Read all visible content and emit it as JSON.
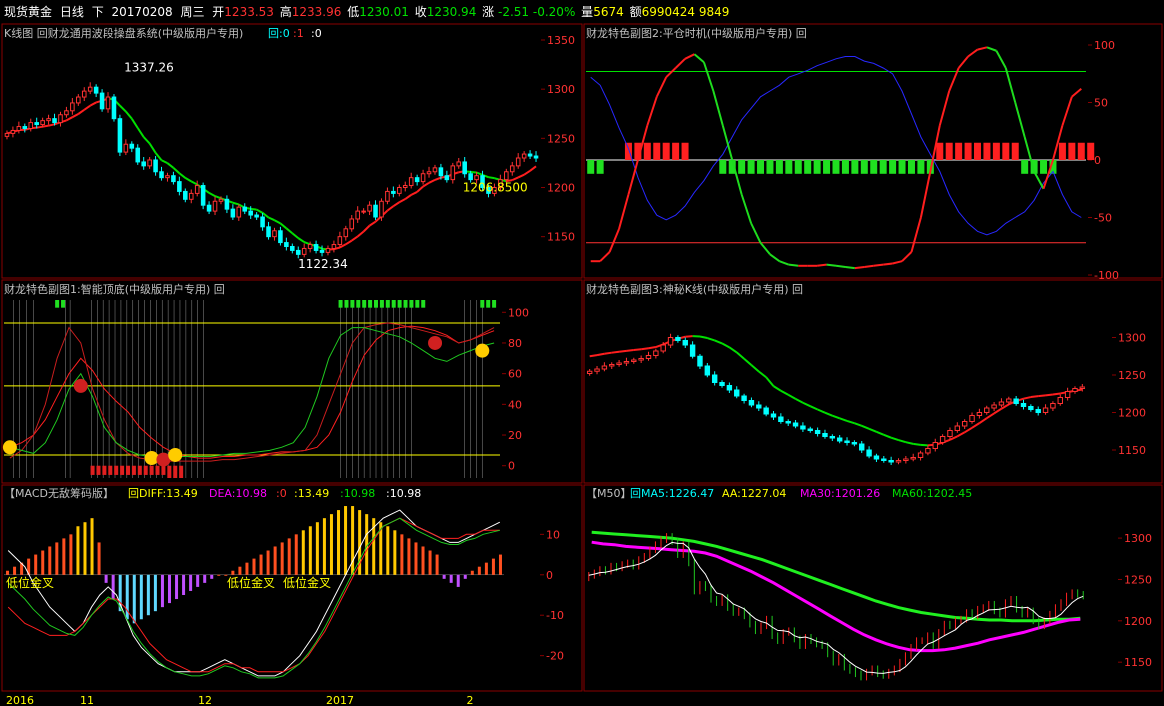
{
  "topbar": {
    "symbol": "现货黄金",
    "period": "日线",
    "direction": "下",
    "date": "20170208",
    "weekday": "周三",
    "open_label": "开",
    "open": "1233.53",
    "high_label": "高",
    "high": "1233.96",
    "low_label": "低",
    "low": "1230.01",
    "close_label": "收",
    "close": "1230.94",
    "change_label": "涨",
    "change": "-2.51",
    "change_pct": "-0.20%",
    "volume_label": "量",
    "volume": "5674",
    "amount_label": "额",
    "amount": "6990424",
    "extra": "9849"
  },
  "colors": {
    "up": "#ff3232",
    "down": "#00ffff",
    "frame": "#8a0000",
    "ma_green": "#00e000",
    "ma_red": "#ff1e1e",
    "yellow": "#ffff00",
    "magenta": "#ff00ff",
    "white": "#ffffff",
    "blue": "#2020ff"
  },
  "chart_data": [
    {
      "id": "kline",
      "type": "candlestick",
      "title": "K线图 回财龙通用波段操盘系统(中级版用户专用)",
      "legend": [
        {
          "text": "回:0",
          "color": "#00ffff"
        },
        {
          "text": ":1",
          "color": "#ff3232"
        },
        {
          "text": ":0",
          "color": "#ffffff"
        }
      ],
      "ylim": [
        1110,
        1350
      ],
      "yticks": [
        "1350",
        "1300",
        "1250",
        "1200",
        "1150"
      ],
      "annotations": [
        "1337.26",
        "1122.34",
        "1206.8500"
      ],
      "close": [
        1255,
        1258,
        1262,
        1260,
        1266,
        1264,
        1268,
        1270,
        1266,
        1274,
        1278,
        1286,
        1292,
        1298,
        1302,
        1296,
        1280,
        1292,
        1270,
        1236,
        1244,
        1240,
        1226,
        1222,
        1228,
        1216,
        1210,
        1212,
        1206,
        1196,
        1188,
        1194,
        1202,
        1182,
        1176,
        1186,
        1188,
        1178,
        1170,
        1180,
        1176,
        1172,
        1170,
        1160,
        1150,
        1156,
        1144,
        1140,
        1136,
        1132,
        1138,
        1142,
        1136,
        1134,
        1138,
        1142,
        1150,
        1158,
        1168,
        1176,
        1176,
        1182,
        1170,
        1186,
        1196,
        1194,
        1200,
        1202,
        1210,
        1206,
        1214,
        1216,
        1220,
        1212,
        1208,
        1222,
        1226,
        1214,
        1208,
        1212,
        1200,
        1194,
        1200,
        1208,
        1216,
        1222,
        1230,
        1234,
        1232,
        1230
      ]
    },
    {
      "id": "sub2",
      "type": "line",
      "title": "财龙特色副图2:平仓时机(中级版用户专用) 回",
      "ylim": [
        -100,
        100
      ],
      "yticks": [
        "100",
        "50",
        "0",
        "-50",
        "-100"
      ],
      "hlines": [
        77,
        -72,
        0
      ],
      "red": [
        -88,
        -88,
        -80,
        -60,
        -30,
        0,
        30,
        55,
        72,
        80,
        88,
        92,
        85,
        60,
        30,
        0,
        -30,
        -55,
        -72,
        -82,
        -88,
        -91,
        -92,
        -92,
        -92,
        -91,
        -92,
        -93,
        -94,
        -93,
        -92,
        -91,
        -90,
        -88,
        -80,
        -50,
        -10,
        30,
        60,
        80,
        90,
        96,
        98,
        95,
        80,
        50,
        20,
        -10,
        -25,
        0,
        30,
        55,
        62
      ],
      "blue": [
        72,
        65,
        48,
        28,
        10,
        -15,
        -35,
        -48,
        -52,
        -48,
        -40,
        -28,
        -18,
        -5,
        5,
        20,
        35,
        45,
        55,
        60,
        65,
        72,
        75,
        78,
        82,
        85,
        88,
        90,
        90,
        86,
        84,
        80,
        75,
        60,
        40,
        20,
        5,
        -10,
        -30,
        -45,
        -55,
        -62,
        -65,
        -62,
        -55,
        -50,
        -45,
        -35,
        -20,
        -10,
        -30,
        -45,
        -50
      ],
      "bars": [
        {
          "from": 0,
          "to": 1,
          "value": -12
        },
        {
          "from": 4,
          "to": 10,
          "value": 15
        },
        {
          "from": 14,
          "to": 36,
          "value": -12
        },
        {
          "from": 37,
          "to": 45,
          "value": 15
        },
        {
          "from": 46,
          "to": 49,
          "value": -12
        },
        {
          "from": 50,
          "to": 53,
          "value": 15
        }
      ]
    },
    {
      "id": "sub1",
      "type": "line",
      "title": "财龙特色副图1:智能顶底(中级版用户专用) 回",
      "ylim": [
        -8,
        108
      ],
      "yticks": [
        "100",
        "80",
        "60",
        "40",
        "20",
        "0"
      ],
      "hlines": [
        93,
        52,
        7
      ],
      "red_line": [
        12,
        15,
        20,
        30,
        45,
        60,
        70,
        62,
        50,
        42,
        35,
        25,
        18,
        12,
        8,
        6,
        5,
        5,
        6,
        6,
        7,
        7,
        8,
        9,
        9,
        10,
        12,
        20,
        35,
        55,
        72,
        82,
        88,
        90,
        91,
        90,
        88,
        85,
        80,
        82,
        85,
        88
      ],
      "red_line_b": [
        5,
        10,
        20,
        40,
        70,
        90,
        80,
        50,
        30,
        15,
        8,
        5,
        4,
        3,
        3,
        3,
        3,
        3,
        4,
        4,
        5,
        6,
        7,
        8,
        9,
        10,
        20,
        40,
        60,
        80,
        90,
        92,
        93,
        92,
        90,
        88,
        86,
        84,
        80,
        82,
        86,
        90
      ],
      "green_line": [
        12,
        10,
        8,
        15,
        30,
        50,
        60,
        45,
        25,
        15,
        10,
        7,
        6,
        6,
        6,
        6,
        6,
        6,
        7,
        8,
        8,
        9,
        10,
        12,
        15,
        25,
        45,
        70,
        85,
        90,
        90,
        88,
        86,
        84,
        80,
        75,
        70,
        68,
        72,
        75,
        78,
        80
      ],
      "dots": [
        {
          "x": 0,
          "y": 12,
          "kind": "smile"
        },
        {
          "x": 6,
          "y": 52,
          "kind": "red"
        },
        {
          "x": 12,
          "y": 5,
          "kind": "smile"
        },
        {
          "x": 13,
          "y": 4,
          "kind": "red"
        },
        {
          "x": 14,
          "y": 7,
          "kind": "smile"
        },
        {
          "x": 36,
          "y": 80,
          "kind": "red"
        },
        {
          "x": 40,
          "y": 75,
          "kind": "smile"
        }
      ],
      "bottom_bars": [
        {
          "from": 7,
          "to": 13,
          "value": -6
        },
        {
          "from": 13.5,
          "to": 14.5,
          "value": -8
        }
      ],
      "top_bars": [
        {
          "from": 4,
          "to": 4.5,
          "value": 103
        },
        {
          "from": 28,
          "to": 35,
          "value": 103
        },
        {
          "from": 40,
          "to": 41,
          "value": 103
        }
      ],
      "vlines": [
        0.3,
        0.8,
        1.4,
        2.0,
        4.7,
        5.1,
        6.9,
        7.4,
        7.9,
        8.4,
        8.9,
        9.4,
        9.9,
        10.4,
        10.9,
        11.4,
        11.9,
        12.4,
        12.9,
        13.4,
        13.9,
        14.4,
        14.9,
        15.4,
        15.9,
        16.4,
        28.0,
        28.5,
        29.0,
        29.5,
        30.0,
        30.5,
        31.0,
        31.5,
        32.0,
        32.5,
        33.0,
        33.5,
        34.0,
        38.5,
        39.0,
        39.5,
        40.0
      ]
    },
    {
      "id": "sub3",
      "type": "candlestick",
      "title": "财龙特色副图3:神秘K线(中级版用户专用) 回",
      "ylim": [
        1110,
        1350
      ],
      "yticks": [
        "1300",
        "1250",
        "1200",
        "1150"
      ],
      "close": [
        1255,
        1258,
        1262,
        1264,
        1266,
        1268,
        1270,
        1272,
        1276,
        1282,
        1290,
        1300,
        1296,
        1290,
        1275,
        1262,
        1250,
        1240,
        1236,
        1230,
        1222,
        1216,
        1210,
        1206,
        1198,
        1194,
        1188,
        1186,
        1182,
        1178,
        1176,
        1172,
        1168,
        1166,
        1162,
        1160,
        1158,
        1150,
        1142,
        1138,
        1136,
        1134,
        1136,
        1138,
        1140,
        1146,
        1152,
        1160,
        1168,
        1176,
        1182,
        1188,
        1196,
        1200,
        1206,
        1210,
        1214,
        1218,
        1212,
        1208,
        1204,
        1200,
        1206,
        1212,
        1220,
        1228,
        1232,
        1234
      ]
    },
    {
      "id": "macd",
      "type": "bar",
      "title": "【MACD无敌筹码版】",
      "legend": [
        {
          "text": "回DIFF:13.49",
          "color": "#ffff00"
        },
        {
          "text": "DEA:10.98",
          "color": "#ff00ff"
        },
        {
          "text": ":0",
          "color": "#ff3232"
        },
        {
          "text": ":13.49",
          "color": "#ffff00"
        },
        {
          "text": ":10.98",
          "color": "#00e000"
        },
        {
          "text": ":10.98",
          "color": "#ffffff"
        }
      ],
      "ylim": [
        -28,
        18
      ],
      "yticks": [
        "10",
        "0",
        "-10",
        "-20"
      ],
      "annotations": [
        "低位金叉",
        "低位金叉",
        "低位金叉"
      ],
      "xticks": [
        "2016",
        "11",
        "12",
        "2017",
        "2"
      ],
      "hist": [
        1,
        2,
        3,
        4,
        5,
        6,
        7,
        8,
        9,
        10,
        12,
        13,
        14,
        8,
        -2,
        -6,
        -9,
        -11,
        -12,
        -11,
        -10,
        -9,
        -8,
        -7,
        -6,
        -5,
        -4,
        -3,
        -2,
        -1,
        0,
        0,
        1,
        2,
        3,
        4,
        5,
        6,
        7,
        8,
        9,
        10,
        11,
        12,
        13,
        14,
        15,
        16,
        17,
        17,
        16,
        15,
        14,
        13,
        12,
        11,
        10,
        9,
        8,
        7,
        6,
        5,
        -1,
        -2,
        -3,
        -1,
        1,
        2,
        3,
        4,
        5
      ],
      "diff": [
        6,
        4,
        2,
        -2,
        -5,
        -8,
        -10,
        -12,
        -14,
        -12,
        -8,
        -5,
        -3,
        -5,
        -10,
        -15,
        -18,
        -20,
        -22,
        -23,
        -24,
        -24,
        -24,
        -24,
        -23,
        -22,
        -21,
        -22,
        -23,
        -24,
        -25,
        -25,
        -25,
        -24,
        -22,
        -20,
        -17,
        -14,
        -10,
        -6,
        -2,
        2,
        6,
        10,
        12,
        14,
        15,
        16,
        14,
        12,
        11,
        10,
        9,
        8,
        8,
        9,
        10,
        11,
        12,
        13
      ],
      "dea": [
        -8,
        -10,
        -12,
        -13,
        -14,
        -15,
        -15,
        -15,
        -14,
        -12,
        -10,
        -8,
        -6,
        -6,
        -8,
        -11,
        -14,
        -17,
        -19,
        -21,
        -22,
        -23,
        -24,
        -24,
        -24,
        -23,
        -22,
        -22,
        -23,
        -23,
        -24,
        -24,
        -24,
        -24,
        -23,
        -22,
        -20,
        -17,
        -14,
        -10,
        -6,
        -2,
        2,
        6,
        9,
        12,
        13,
        14,
        13,
        12,
        11,
        10,
        9,
        9,
        9,
        10,
        10,
        11,
        11,
        11
      ]
    },
    {
      "id": "m50",
      "type": "line",
      "title": "【M50】",
      "legend": [
        {
          "text": "回MA5:1226.47",
          "color": "#00ffff"
        },
        {
          "text": "AA:1227.04",
          "color": "#ffff00"
        },
        {
          "text": "MA30:1201.26",
          "color": "#ff00ff"
        },
        {
          "text": "MA60:1202.45",
          "color": "#00e000"
        }
      ],
      "ylim": [
        1120,
        1340
      ],
      "yticks": [
        "1300",
        "1250",
        "1200",
        "1150"
      ],
      "ma60": [
        1307,
        1306,
        1305,
        1304,
        1303,
        1302,
        1301,
        1300,
        1298,
        1296,
        1293,
        1290,
        1286,
        1282,
        1278,
        1274,
        1269,
        1264,
        1259,
        1254,
        1249,
        1244,
        1239,
        1234,
        1229,
        1224,
        1220,
        1216,
        1213,
        1210,
        1208,
        1206,
        1204,
        1203,
        1202,
        1201,
        1201,
        1200,
        1200,
        1200,
        1201,
        1202,
        1202,
        1203
      ],
      "ma30": [
        1295,
        1293,
        1292,
        1290,
        1289,
        1288,
        1287,
        1286,
        1285,
        1284,
        1282,
        1278,
        1272,
        1266,
        1260,
        1253,
        1246,
        1238,
        1230,
        1222,
        1214,
        1206,
        1198,
        1190,
        1183,
        1177,
        1172,
        1168,
        1165,
        1164,
        1164,
        1165,
        1167,
        1170,
        1173,
        1177,
        1180,
        1183,
        1186,
        1190,
        1194,
        1198,
        1201,
        1202
      ]
    }
  ]
}
